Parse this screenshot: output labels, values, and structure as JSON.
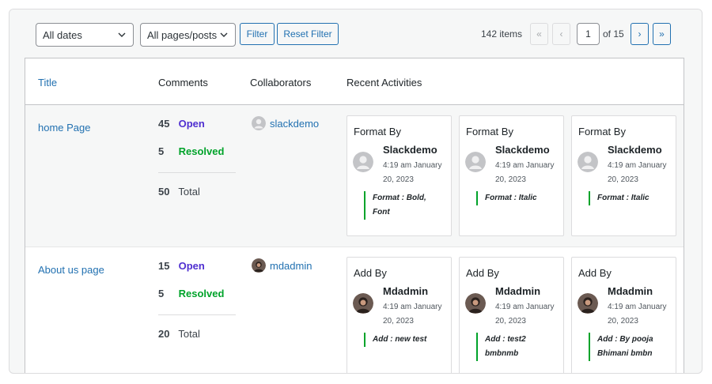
{
  "toolbar": {
    "dates_select": "All dates",
    "pages_select": "All pages/posts",
    "filter_label": "Filter",
    "reset_label": "Reset Filter"
  },
  "pagination": {
    "items": "142 items",
    "first": "«",
    "prev": "‹",
    "current": "1",
    "of": "of 15",
    "next": "›",
    "last": "»"
  },
  "table": {
    "headers": {
      "title": "Title",
      "comments": "Comments",
      "collaborators": "Collaborators",
      "recent": "Recent Activities"
    },
    "rows": [
      {
        "title": "home Page",
        "open_count": "45",
        "open_label": "Open",
        "resolved_count": "5",
        "resolved_label": "Resolved",
        "total_count": "50",
        "total_label": "Total",
        "collaborator": "slackdemo",
        "activities": [
          {
            "heading": "Format By",
            "user": "Slackdemo",
            "time": "4:19 am January 20, 2023",
            "note": "Format : Bold, Font"
          },
          {
            "heading": "Format By",
            "user": "Slackdemo",
            "time": "4:19 am January 20, 2023",
            "note": "Format : Italic"
          },
          {
            "heading": "Format By",
            "user": "Slackdemo",
            "time": "4:19 am January 20, 2023",
            "note": "Format : Italic"
          }
        ]
      },
      {
        "title": "About us page",
        "open_count": "15",
        "open_label": "Open",
        "resolved_count": "5",
        "resolved_label": "Resolved",
        "total_count": "20",
        "total_label": "Total",
        "collaborator": "mdadmin",
        "activities": [
          {
            "heading": "Add By",
            "user": "Mdadmin",
            "time": "4:19 am January 20, 2023",
            "note": "Add : new test"
          },
          {
            "heading": "Add By",
            "user": "Mdadmin",
            "time": "4:19 am January 20, 2023",
            "note": "Add : test2 bmbnmb"
          },
          {
            "heading": "Add By",
            "user": "Mdadmin",
            "time": "4:19 am January 20, 2023",
            "note": "Add : By pooja Bhimani bmbn"
          }
        ]
      }
    ]
  },
  "colors": {
    "link": "#2271b1",
    "open": "#4f2fd0",
    "resolved": "#00a32a"
  },
  "icons": {
    "default_avatar": "person-placeholder-icon",
    "user_avatar": "user-photo-icon",
    "select_arrow": "chevron-down-icon"
  }
}
